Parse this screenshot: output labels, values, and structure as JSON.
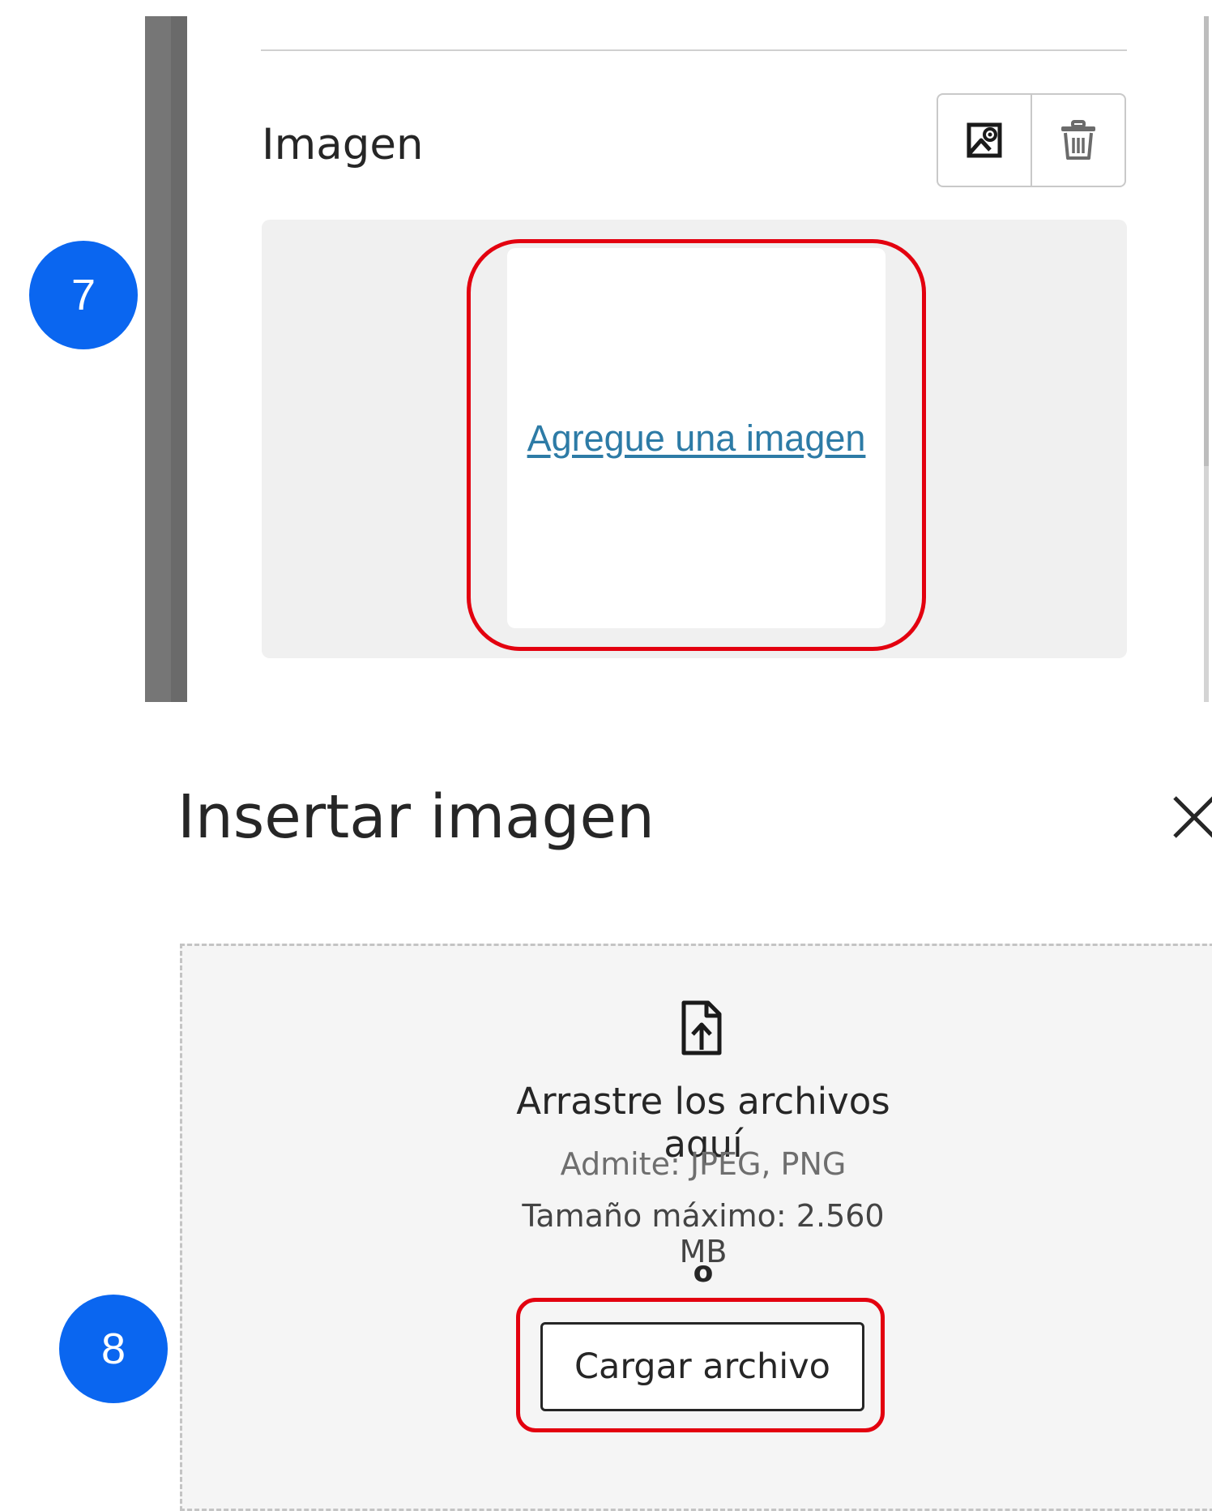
{
  "section": {
    "title": "Imagen",
    "toolbar": {
      "insert_icon": "image-insert-icon",
      "delete_icon": "trash-icon"
    },
    "add_image_link": "Agregue una imagen"
  },
  "annotations": {
    "step_7": "7",
    "step_8": "8",
    "highlight_color": "#e3000f",
    "badge_color": "#0a66f0"
  },
  "dialog": {
    "title": "Insertar imagen",
    "close_icon": "close-icon",
    "dropzone": {
      "icon": "file-upload-icon",
      "heading": "Arrastre los archivos aquí",
      "supports": "Admite: JPEG, PNG",
      "max_size": "Tamaño máximo: 2.560 MB",
      "or": "o",
      "upload_button": "Cargar archivo"
    }
  },
  "colors": {
    "link": "#2d7ba6",
    "panel_bg": "#f0f0f0",
    "dropzone_bg": "#f5f5f5"
  }
}
